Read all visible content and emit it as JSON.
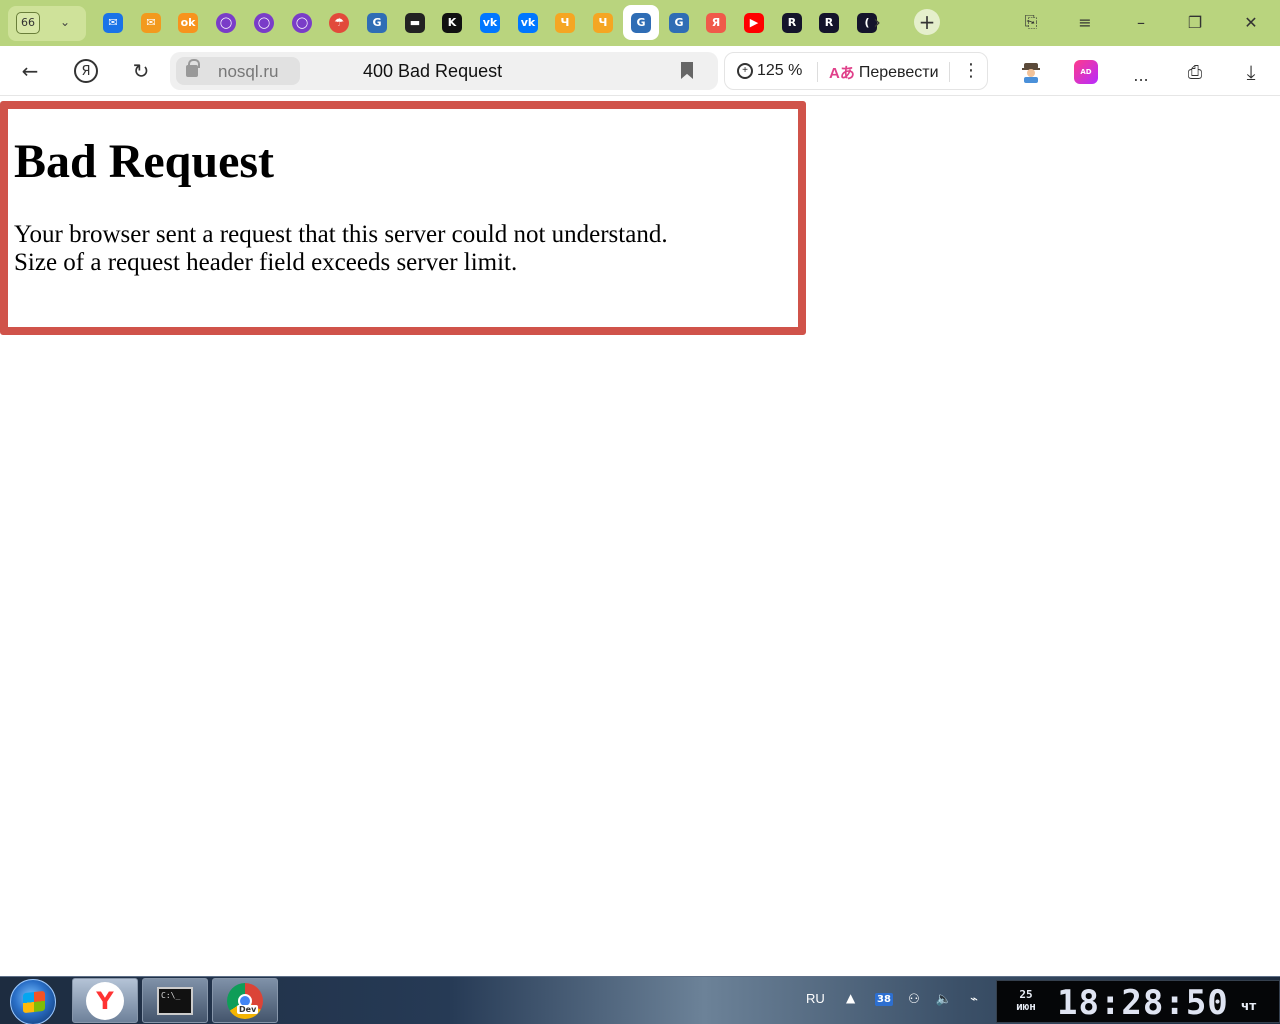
{
  "browser": {
    "tab_count": "66",
    "tabs": [
      {
        "icon": "mail-icon",
        "color": "#1a73e8",
        "glyph": "✉"
      },
      {
        "icon": "envelope-icon",
        "color": "#f29a1e",
        "glyph": "✉"
      },
      {
        "icon": "odnoklassniki-icon",
        "color": "#f7931e",
        "glyph": "ok"
      },
      {
        "icon": "ring-icon",
        "color": "#7a3cc8",
        "glyph": "◯"
      },
      {
        "icon": "ring-icon",
        "color": "#7a3cc8",
        "glyph": "◯"
      },
      {
        "icon": "ring-icon",
        "color": "#7a3cc8",
        "glyph": "◯"
      },
      {
        "icon": "umbrella-icon",
        "color": "#e24a3b",
        "glyph": "☂"
      },
      {
        "icon": "doc-icon",
        "color": "#2f6db5",
        "glyph": "G"
      },
      {
        "icon": "terminal-icon",
        "color": "#222222",
        "glyph": "▬"
      },
      {
        "icon": "kinopoisk-icon",
        "color": "#111111",
        "glyph": "K"
      },
      {
        "icon": "vk-icon",
        "color": "#0077ff",
        "glyph": "vk"
      },
      {
        "icon": "vk-icon",
        "color": "#0077ff",
        "glyph": "vk"
      },
      {
        "icon": "shield-icon",
        "color": "#f5a623",
        "glyph": "Ч"
      },
      {
        "icon": "shield-icon",
        "color": "#f5a623",
        "glyph": "Ч"
      },
      {
        "icon": "doc-icon",
        "color": "#2f6db5",
        "glyph": "G"
      },
      {
        "icon": "doc-icon",
        "color": "#2f6db5",
        "glyph": "G"
      },
      {
        "icon": "yandex-icon",
        "color": "#f05a4a",
        "glyph": "Я"
      },
      {
        "icon": "youtube-icon",
        "color": "#ff0000",
        "glyph": "▶"
      },
      {
        "icon": "rutube-icon",
        "color": "#14142b",
        "glyph": "R"
      },
      {
        "icon": "rutube-icon",
        "color": "#14142b",
        "glyph": "R"
      },
      {
        "icon": "bracket-icon",
        "color": "#14142b",
        "glyph": "("
      }
    ],
    "address": {
      "domain": "nosql.ru",
      "page_title": "400 Bad Request"
    },
    "zoom": "125 %",
    "translate_label": "Перевести",
    "more_label": "..."
  },
  "page": {
    "heading": "Bad Request",
    "lines": [
      "Your browser sent a request that this server could not understand.",
      "Size of a request header field exceeds server limit."
    ]
  },
  "taskbar": {
    "lang": "RU",
    "tray_badge": "38",
    "date_day": "25",
    "date_month": "июн",
    "time": "18:28:50",
    "weekday": "чт",
    "apps": [
      {
        "name": "yandex-browser",
        "label": "Y"
      },
      {
        "name": "terminal",
        "label": "C:\\_"
      },
      {
        "name": "chrome-dev",
        "label": "Dev"
      }
    ]
  }
}
